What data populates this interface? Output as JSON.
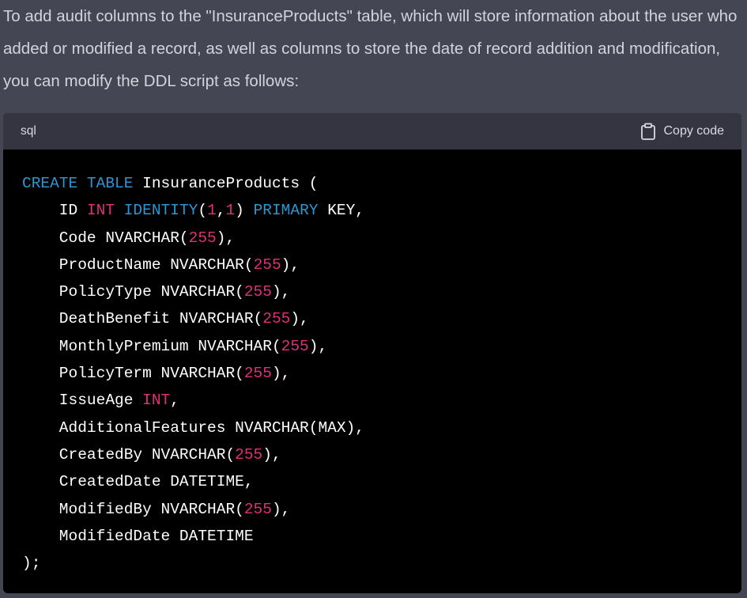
{
  "message": {
    "intro": "To add audit columns to the \"InsuranceProducts\" table, which will store information about the user who added or modified a record, as well as columns to store the date of record addition and modification, you can modify the DDL script as follows:"
  },
  "code_block": {
    "language": "sql",
    "copy_label": "Copy code",
    "copy_icon": "clipboard-icon",
    "colors": {
      "keyword": "#2e95d3",
      "number": "#df3079",
      "plain": "#ffffff"
    },
    "lines": [
      [
        [
          "kw",
          "CREATE"
        ],
        [
          "p",
          " "
        ],
        [
          "kw",
          "TABLE"
        ],
        [
          "p",
          " InsuranceProducts ("
        ]
      ],
      [
        [
          "p",
          "    ID "
        ],
        [
          "num",
          "INT"
        ],
        [
          "p",
          " "
        ],
        [
          "kw",
          "IDENTITY"
        ],
        [
          "p",
          "("
        ],
        [
          "num",
          "1"
        ],
        [
          "p",
          ","
        ],
        [
          "num",
          "1"
        ],
        [
          "p",
          ") "
        ],
        [
          "kw",
          "PRIMARY"
        ],
        [
          "p",
          " KEY,"
        ]
      ],
      [
        [
          "p",
          "    Code NVARCHAR("
        ],
        [
          "num",
          "255"
        ],
        [
          "p",
          "),"
        ]
      ],
      [
        [
          "p",
          "    ProductName NVARCHAR("
        ],
        [
          "num",
          "255"
        ],
        [
          "p",
          "),"
        ]
      ],
      [
        [
          "p",
          "    PolicyType NVARCHAR("
        ],
        [
          "num",
          "255"
        ],
        [
          "p",
          "),"
        ]
      ],
      [
        [
          "p",
          "    DeathBenefit NVARCHAR("
        ],
        [
          "num",
          "255"
        ],
        [
          "p",
          "),"
        ]
      ],
      [
        [
          "p",
          "    MonthlyPremium NVARCHAR("
        ],
        [
          "num",
          "255"
        ],
        [
          "p",
          "),"
        ]
      ],
      [
        [
          "p",
          "    PolicyTerm NVARCHAR("
        ],
        [
          "num",
          "255"
        ],
        [
          "p",
          "),"
        ]
      ],
      [
        [
          "p",
          "    IssueAge "
        ],
        [
          "num",
          "INT"
        ],
        [
          "p",
          ","
        ]
      ],
      [
        [
          "p",
          "    AdditionalFeatures NVARCHAR(MAX),"
        ]
      ],
      [
        [
          "p",
          "    CreatedBy NVARCHAR("
        ],
        [
          "num",
          "255"
        ],
        [
          "p",
          "),"
        ]
      ],
      [
        [
          "p",
          "    CreatedDate DATETIME,"
        ]
      ],
      [
        [
          "p",
          "    ModifiedBy NVARCHAR("
        ],
        [
          "num",
          "255"
        ],
        [
          "p",
          "),"
        ]
      ],
      [
        [
          "p",
          "    ModifiedDate DATETIME"
        ]
      ],
      [
        [
          "p",
          ");"
        ]
      ]
    ]
  }
}
